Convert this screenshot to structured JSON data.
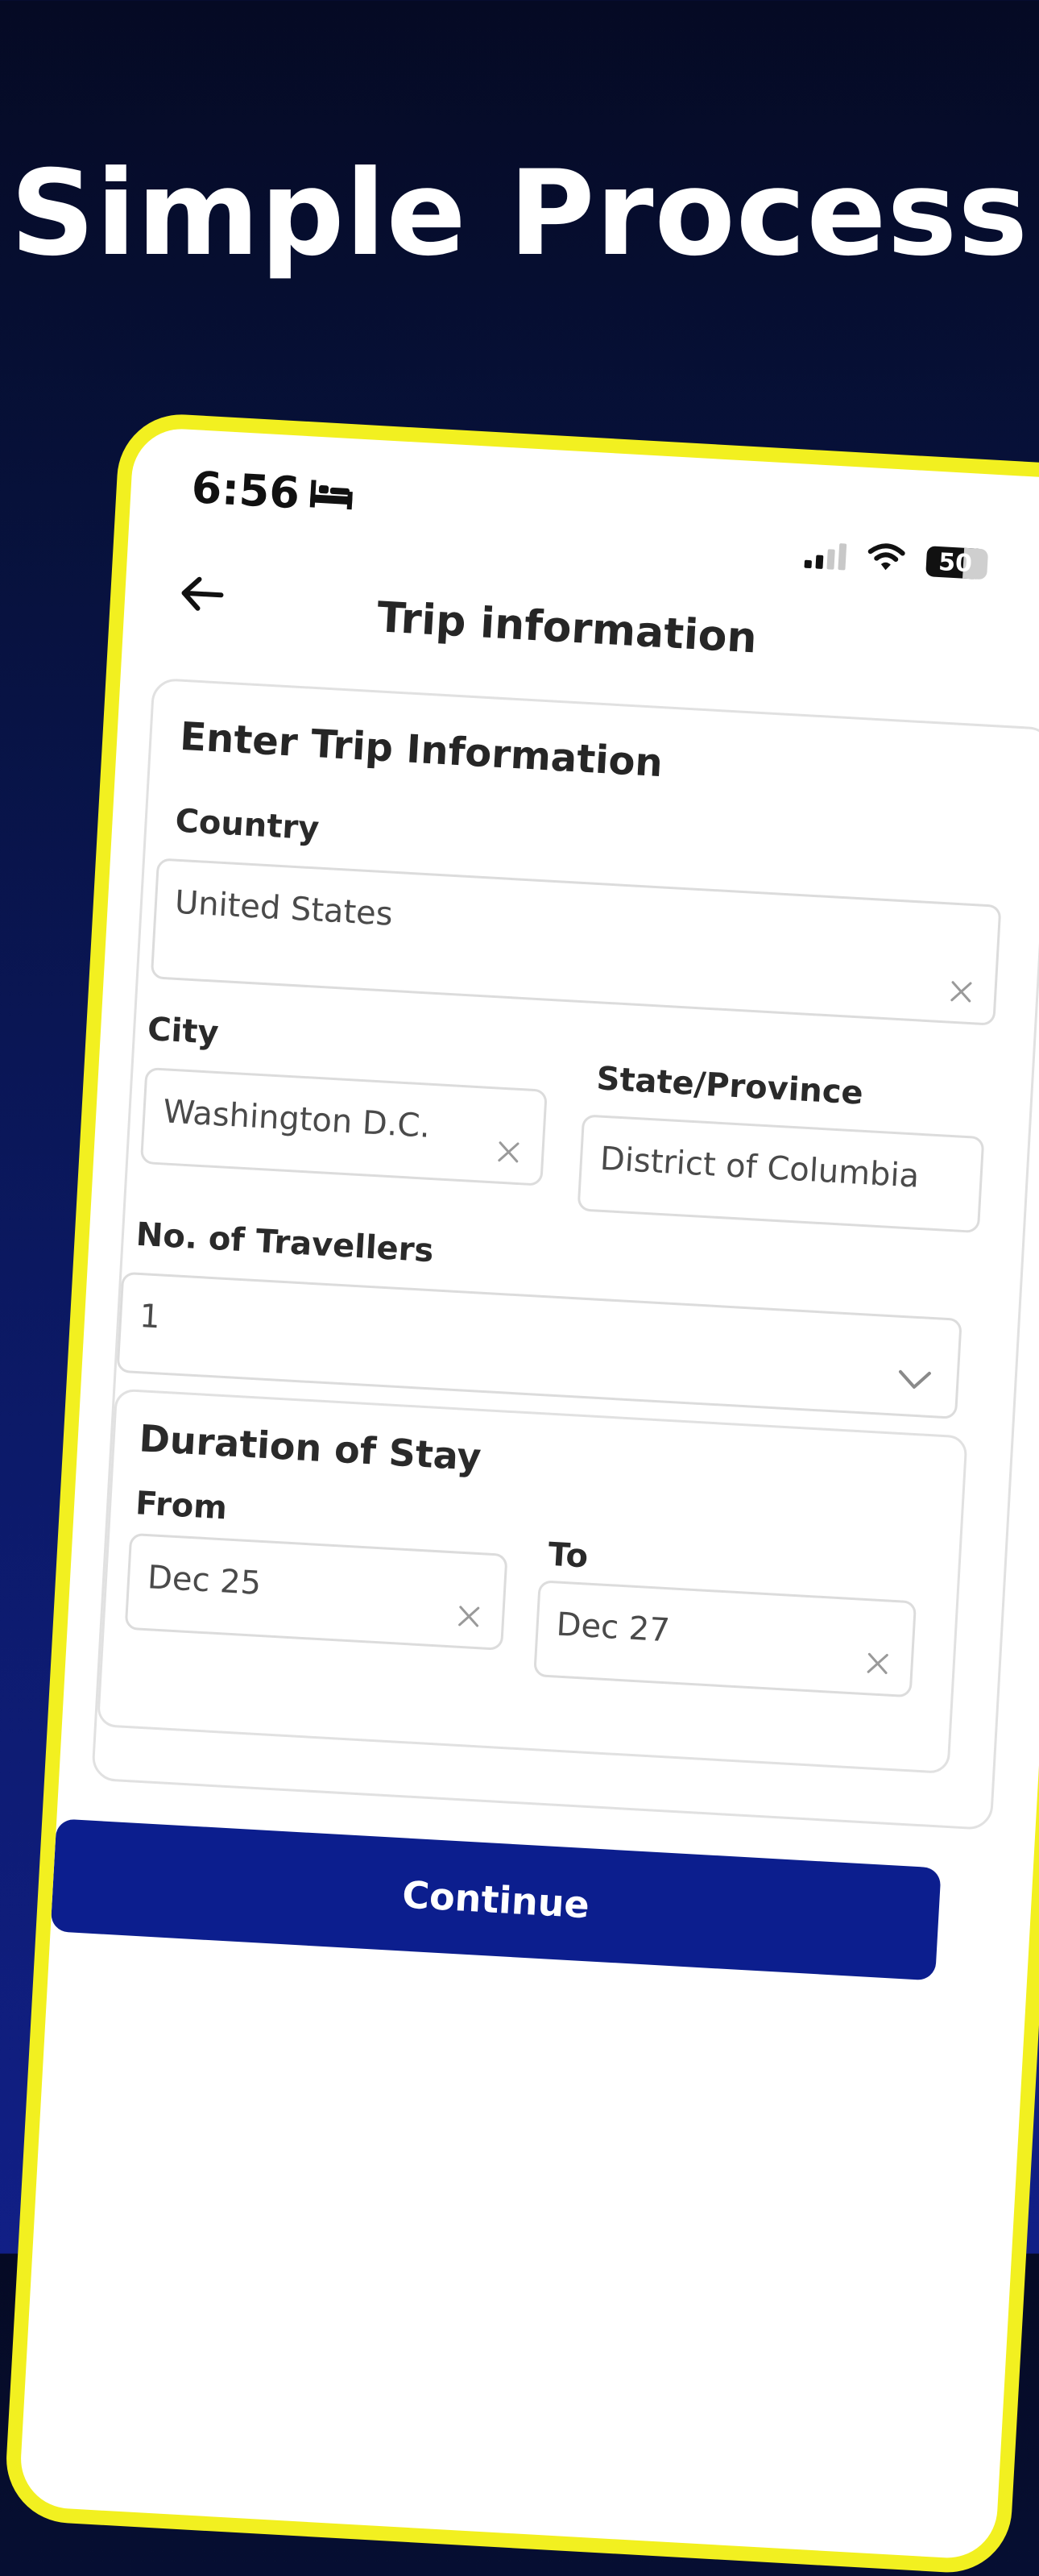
{
  "promo": {
    "headline": "Simple Process"
  },
  "status_bar": {
    "time": "6:56",
    "battery": "50"
  },
  "header": {
    "title": "Trip information"
  },
  "form": {
    "section_title": "Enter Trip Information",
    "country": {
      "label": "Country",
      "value": "United States"
    },
    "city": {
      "label": "City",
      "value": "Washington D.C."
    },
    "state": {
      "label": "State/Province",
      "value": "District of Columbia"
    },
    "travellers": {
      "label": "No. of Travellers",
      "value": "1"
    },
    "duration": {
      "title": "Duration of Stay",
      "from_label": "From",
      "from_value": "Dec 25",
      "to_label": "To",
      "to_value": "Dec 27"
    }
  },
  "actions": {
    "continue_label": "Continue"
  },
  "colors": {
    "frame": "#f2f020",
    "button": "#0c1e8e",
    "background_top": "#050a24",
    "background_bottom": "#111f86"
  },
  "icons": [
    "back-arrow-icon",
    "bed-icon",
    "signal-icon",
    "wifi-icon",
    "battery-icon",
    "clear-icon",
    "chevron-down-icon"
  ]
}
